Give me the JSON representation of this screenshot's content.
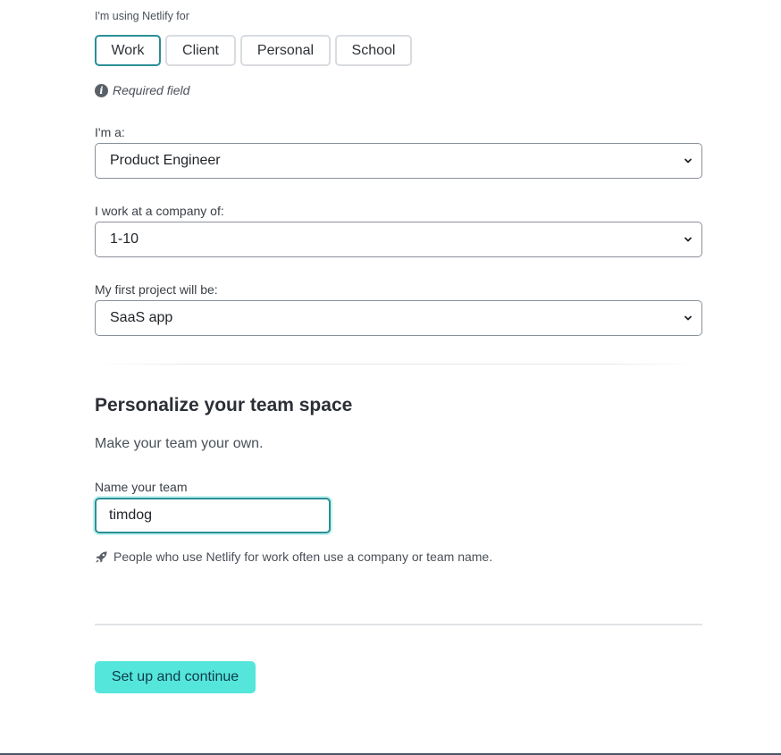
{
  "usage": {
    "label": "I'm using Netlify for",
    "options": [
      "Work",
      "Client",
      "Personal",
      "School"
    ],
    "selected": "Work",
    "required_text": "Required field"
  },
  "role": {
    "label": "I'm a:",
    "value": "Product Engineer"
  },
  "company_size": {
    "label": "I work at a company of:",
    "value": "1-10"
  },
  "first_project": {
    "label": "My first project will be:",
    "value": "SaaS app"
  },
  "team": {
    "heading": "Personalize your team space",
    "subtitle": "Make your team your own.",
    "name_label": "Name your team",
    "name_value": "timdog",
    "hint": "People who use Netlify for work often use a company or team name."
  },
  "actions": {
    "continue_label": "Set up and continue"
  },
  "colors": {
    "accent_border": "#2b8f96",
    "primary_button": "#55e6db",
    "primary_button_text": "#0d3a49"
  },
  "icons": {
    "required": "info-icon",
    "hint": "rocket-icon",
    "select": "chevron-down-icon"
  }
}
